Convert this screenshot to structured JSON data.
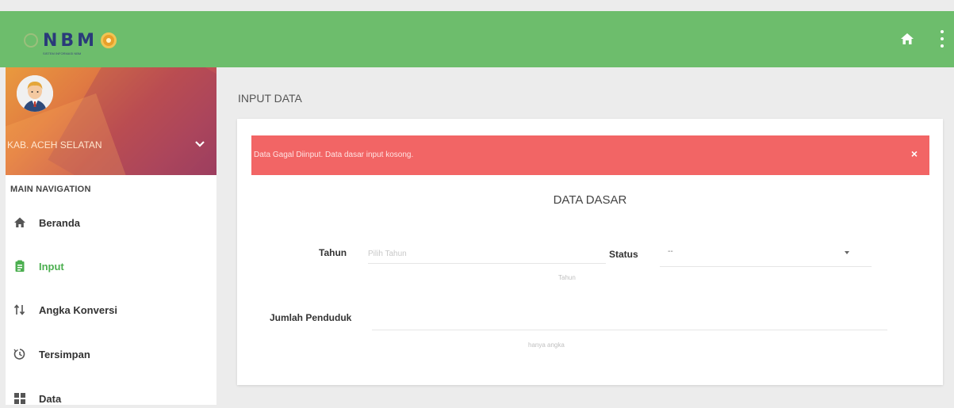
{
  "header": {
    "brand": "NBM",
    "brand_subtitle": "SISTEM INFORMASI NBM",
    "icons": [
      "home-icon",
      "more-vert-icon"
    ],
    "color": "#6dbd6c"
  },
  "sidebar": {
    "user": {
      "name": "KAB. ACEH SELATAN"
    },
    "nav_header": "MAIN NAVIGATION",
    "items": [
      {
        "label": "Beranda",
        "icon": "home-icon",
        "active": false
      },
      {
        "label": "Input",
        "icon": "clipboard-icon",
        "active": true
      },
      {
        "label": "Angka Konversi",
        "icon": "swap-icon",
        "active": false
      },
      {
        "label": "Tersimpan",
        "icon": "history-icon",
        "active": false
      },
      {
        "label": "Data",
        "icon": "grid-icon",
        "active": false
      }
    ],
    "active_color": "#4caf50"
  },
  "main": {
    "page_title": "INPUT DATA",
    "alert": {
      "message": "Data Gagal Diinput. Data dasar input kosong.",
      "close": "×",
      "color": "#f26565"
    },
    "section_title": "DATA DASAR",
    "form": {
      "tahun_label": "Tahun",
      "tahun_placeholder": "Pilih Tahun",
      "tahun_hint": "Tahun",
      "status_label": "Status",
      "status_value": "--",
      "jumlah_label": "Jumlah Penduduk",
      "jumlah_hint": "hanya angka"
    }
  }
}
